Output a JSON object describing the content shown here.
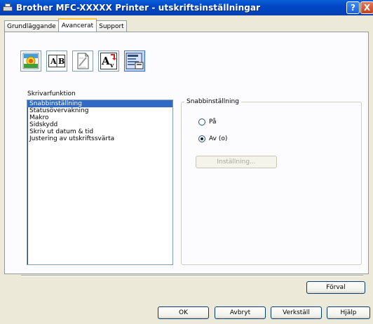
{
  "window": {
    "title": "Brother MFC-XXXXX Printer - utskriftsinställningar"
  },
  "titlebar": {
    "help": "?",
    "close": "X"
  },
  "tabs": [
    {
      "label": "Grundläggande"
    },
    {
      "label": "Avancerat"
    },
    {
      "label": "Support"
    }
  ],
  "toolbar": {
    "icons": [
      "color-icon",
      "scaling-icon",
      "watermark-icon",
      "print-settings-icon",
      "device-options-icon"
    ],
    "scaling_text": "A|B",
    "print_text": "A",
    "print_sub": "V"
  },
  "function_list": {
    "label": "Skrivarfunktion",
    "items": [
      "Snabbinställning",
      "Statusövervakning",
      "Makro",
      "Sidskydd",
      "Skriv ut datum & tid",
      "Justering av utskriftssvärta"
    ],
    "selected_index": 0
  },
  "quick_setup": {
    "group_title": "Snabbinställning",
    "on_label": "På",
    "off_label": "Av (o)",
    "selected": "off",
    "settings_button": "Inställning..."
  },
  "buttons": {
    "default": "Förval",
    "ok": "OK",
    "cancel": "Avbryt",
    "apply": "Verkställ",
    "help": "Hjälp"
  }
}
